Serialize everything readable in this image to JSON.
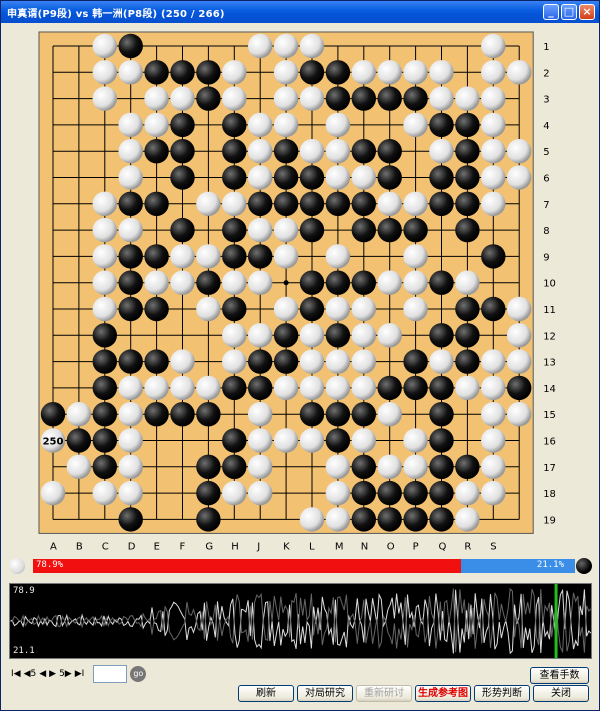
{
  "window": {
    "title": "申真谞(P9段) vs 韩一洲(P8段) (250 / 266)",
    "controls": [
      "minimize",
      "maximize",
      "close"
    ]
  },
  "board": {
    "size": 19,
    "columns": [
      "A",
      "B",
      "C",
      "D",
      "E",
      "F",
      "G",
      "H",
      "J",
      "K",
      "L",
      "M",
      "N",
      "O",
      "P",
      "Q",
      "R",
      "S"
    ],
    "rows": [
      "1",
      "2",
      "3",
      "4",
      "5",
      "6",
      "7",
      "8",
      "9",
      "10",
      "11",
      "12",
      "13",
      "14",
      "15",
      "16",
      "17",
      "18",
      "19"
    ],
    "stones": [
      "..WB....WWW......W.W",
      "..WWBBBW.WBBWWWW.WWW",
      "..W.WWBW.WWBBBBWWW.W",
      "...WWB.BWW.W..WBBW..",
      "...WBB.BWBWWBB.WBWW.",
      "...W.B.BWBBWWB.BBWWB",
      "..WBB.WWBBBBBWWBBW..",
      "..WW.B.BWWB.BBB.B..B",
      "..WBBWWBBW.W..W..B..",
      "..WBWWBWW.BBBWWBW...",
      "..WBB.WB.WBWW.W.BBW.",
      "..B....WWBWBWW.BB.W.",
      "..BBBW.WBBWWW.BWBWW.",
      "..BWWWWBBWWWWBBBWWB.",
      "BWBWBBB.W.BBBW.B.WW.",
      "WBBW...BWWWBW.WB.W..",
      ".WBW..BBW..WBWWBBW..",
      "W.WW..BWW..WBBBBWW..",
      "...B..B...WWBBBBW..."
    ],
    "last_move": {
      "label": "250",
      "col": "A",
      "row": "16"
    }
  },
  "win_rate": {
    "black_label": "78.9%",
    "white_label": "21.1%",
    "black_value": 78.9,
    "white_value": 21.1
  },
  "graph": {
    "max_label": "78.9",
    "min_label": "21.1",
    "current_move_marker": 250,
    "total_moves": 266
  },
  "nav": {
    "first": "I◀",
    "back5": "◀5",
    "prev": "◀",
    "next": "▶",
    "forward5": "5▶",
    "last": "▶I",
    "move_input": "",
    "go": "go"
  },
  "buttons": {
    "view_moves": "查看手数",
    "refresh": "刷新",
    "study": "对局研究",
    "restudy": "重新研讨",
    "gen_ref": "生成参考图",
    "judge": "形势判断",
    "close": "关闭"
  },
  "colors": {
    "board": "#f2c272",
    "black_bar": "#f20f0f",
    "white_bar": "#3a8ee8",
    "graph_green": "#20c020"
  }
}
